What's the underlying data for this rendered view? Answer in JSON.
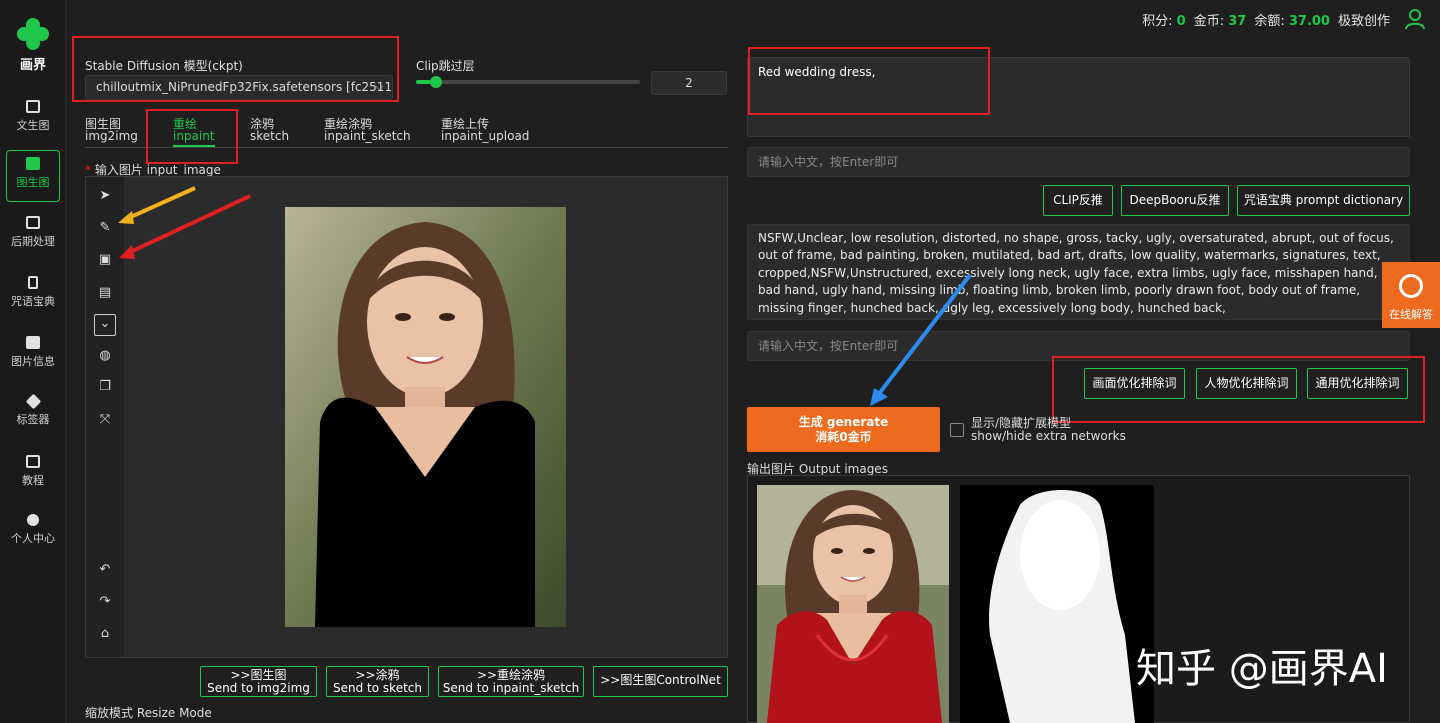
{
  "app": {
    "logo_text": "画界"
  },
  "sidebar": {
    "items": [
      {
        "label": "文生图"
      },
      {
        "label": "图生图"
      },
      {
        "label": "后期处理"
      },
      {
        "label": "咒语宝典"
      },
      {
        "label": "图片信息"
      },
      {
        "label": "标签器"
      },
      {
        "label": "教程"
      },
      {
        "label": "个人中心"
      }
    ]
  },
  "topbar": {
    "points_label": "积分:",
    "points": "0",
    "coins_label": "金币:",
    "coins": "37",
    "balance_label": "余额:",
    "balance": "37.00",
    "mode": "极致创作"
  },
  "model": {
    "label": "Stable Diffusion 模型(ckpt)",
    "value": "chilloutmix_NiPrunedFp32Fix.safetensors [fc2511"
  },
  "clip": {
    "label": "Clip跳过层",
    "value": "2",
    "level_fraction": 0.06
  },
  "tabs": [
    {
      "cn": "图生图",
      "en": "img2img"
    },
    {
      "cn": "重绘",
      "en": "inpaint"
    },
    {
      "cn": "涂鸦",
      "en": "sketch"
    },
    {
      "cn": "重绘涂鸦",
      "en": "inpaint_sketch"
    },
    {
      "cn": "重绘上传",
      "en": "inpaint_upload"
    }
  ],
  "input_image": {
    "required_mark": "*",
    "label": "输入图片 input_image"
  },
  "send_buttons": [
    {
      "cn": ">>图生图",
      "en": "Send to img2img"
    },
    {
      "cn": ">>涂鸦",
      "en": "Send to sketch"
    },
    {
      "cn": ">>重绘涂鸦",
      "en": "Send to inpaint_sketch"
    },
    {
      "cn": ">>图生图ControlNet",
      "en": ""
    }
  ],
  "resize": {
    "label": "缩放模式 Resize Mode"
  },
  "prompt": {
    "value": "Red wedding dress,",
    "cn_placeholder": "请输入中文，按Enter即可"
  },
  "prompt_buttons": [
    "CLIP反推",
    "DeepBooru反推",
    "咒语宝典 prompt dictionary"
  ],
  "negative": {
    "value": "NSFW,Unclear, low resolution, distorted, no shape, gross, tacky, ugly, oversaturated, abrupt, out of focus, out of frame, bad painting, broken, mutilated, bad art, drafts, low quality, watermarks, signatures, text, cropped,NSFW,Unstructured, excessively long neck, ugly face, extra limbs, ugly face, misshapen hand, bad hand, ugly hand, missing limb, floating limb, broken limb, poorly drawn foot, body out of frame, missing finger, hunched back, ugly leg, excessively long body, hunched back,",
    "cn_placeholder": "请输入中文，按Enter即可"
  },
  "negative_buttons": [
    "画面优化排除词",
    "人物优化排除词",
    "通用优化排除词"
  ],
  "generate": {
    "label": "生成 generate",
    "cost": "消耗0金币"
  },
  "extra_networks": {
    "cn": "显示/隐藏扩展模型",
    "en": "show/hide extra networks"
  },
  "output": {
    "label": "输出图片 Output images"
  },
  "watermark": "知乎 @画界AI",
  "help": {
    "label": "在线解答"
  },
  "colors": {
    "accent": "#1fc74a",
    "orange": "#ee6a1e",
    "annotation_red": "#e02020"
  }
}
